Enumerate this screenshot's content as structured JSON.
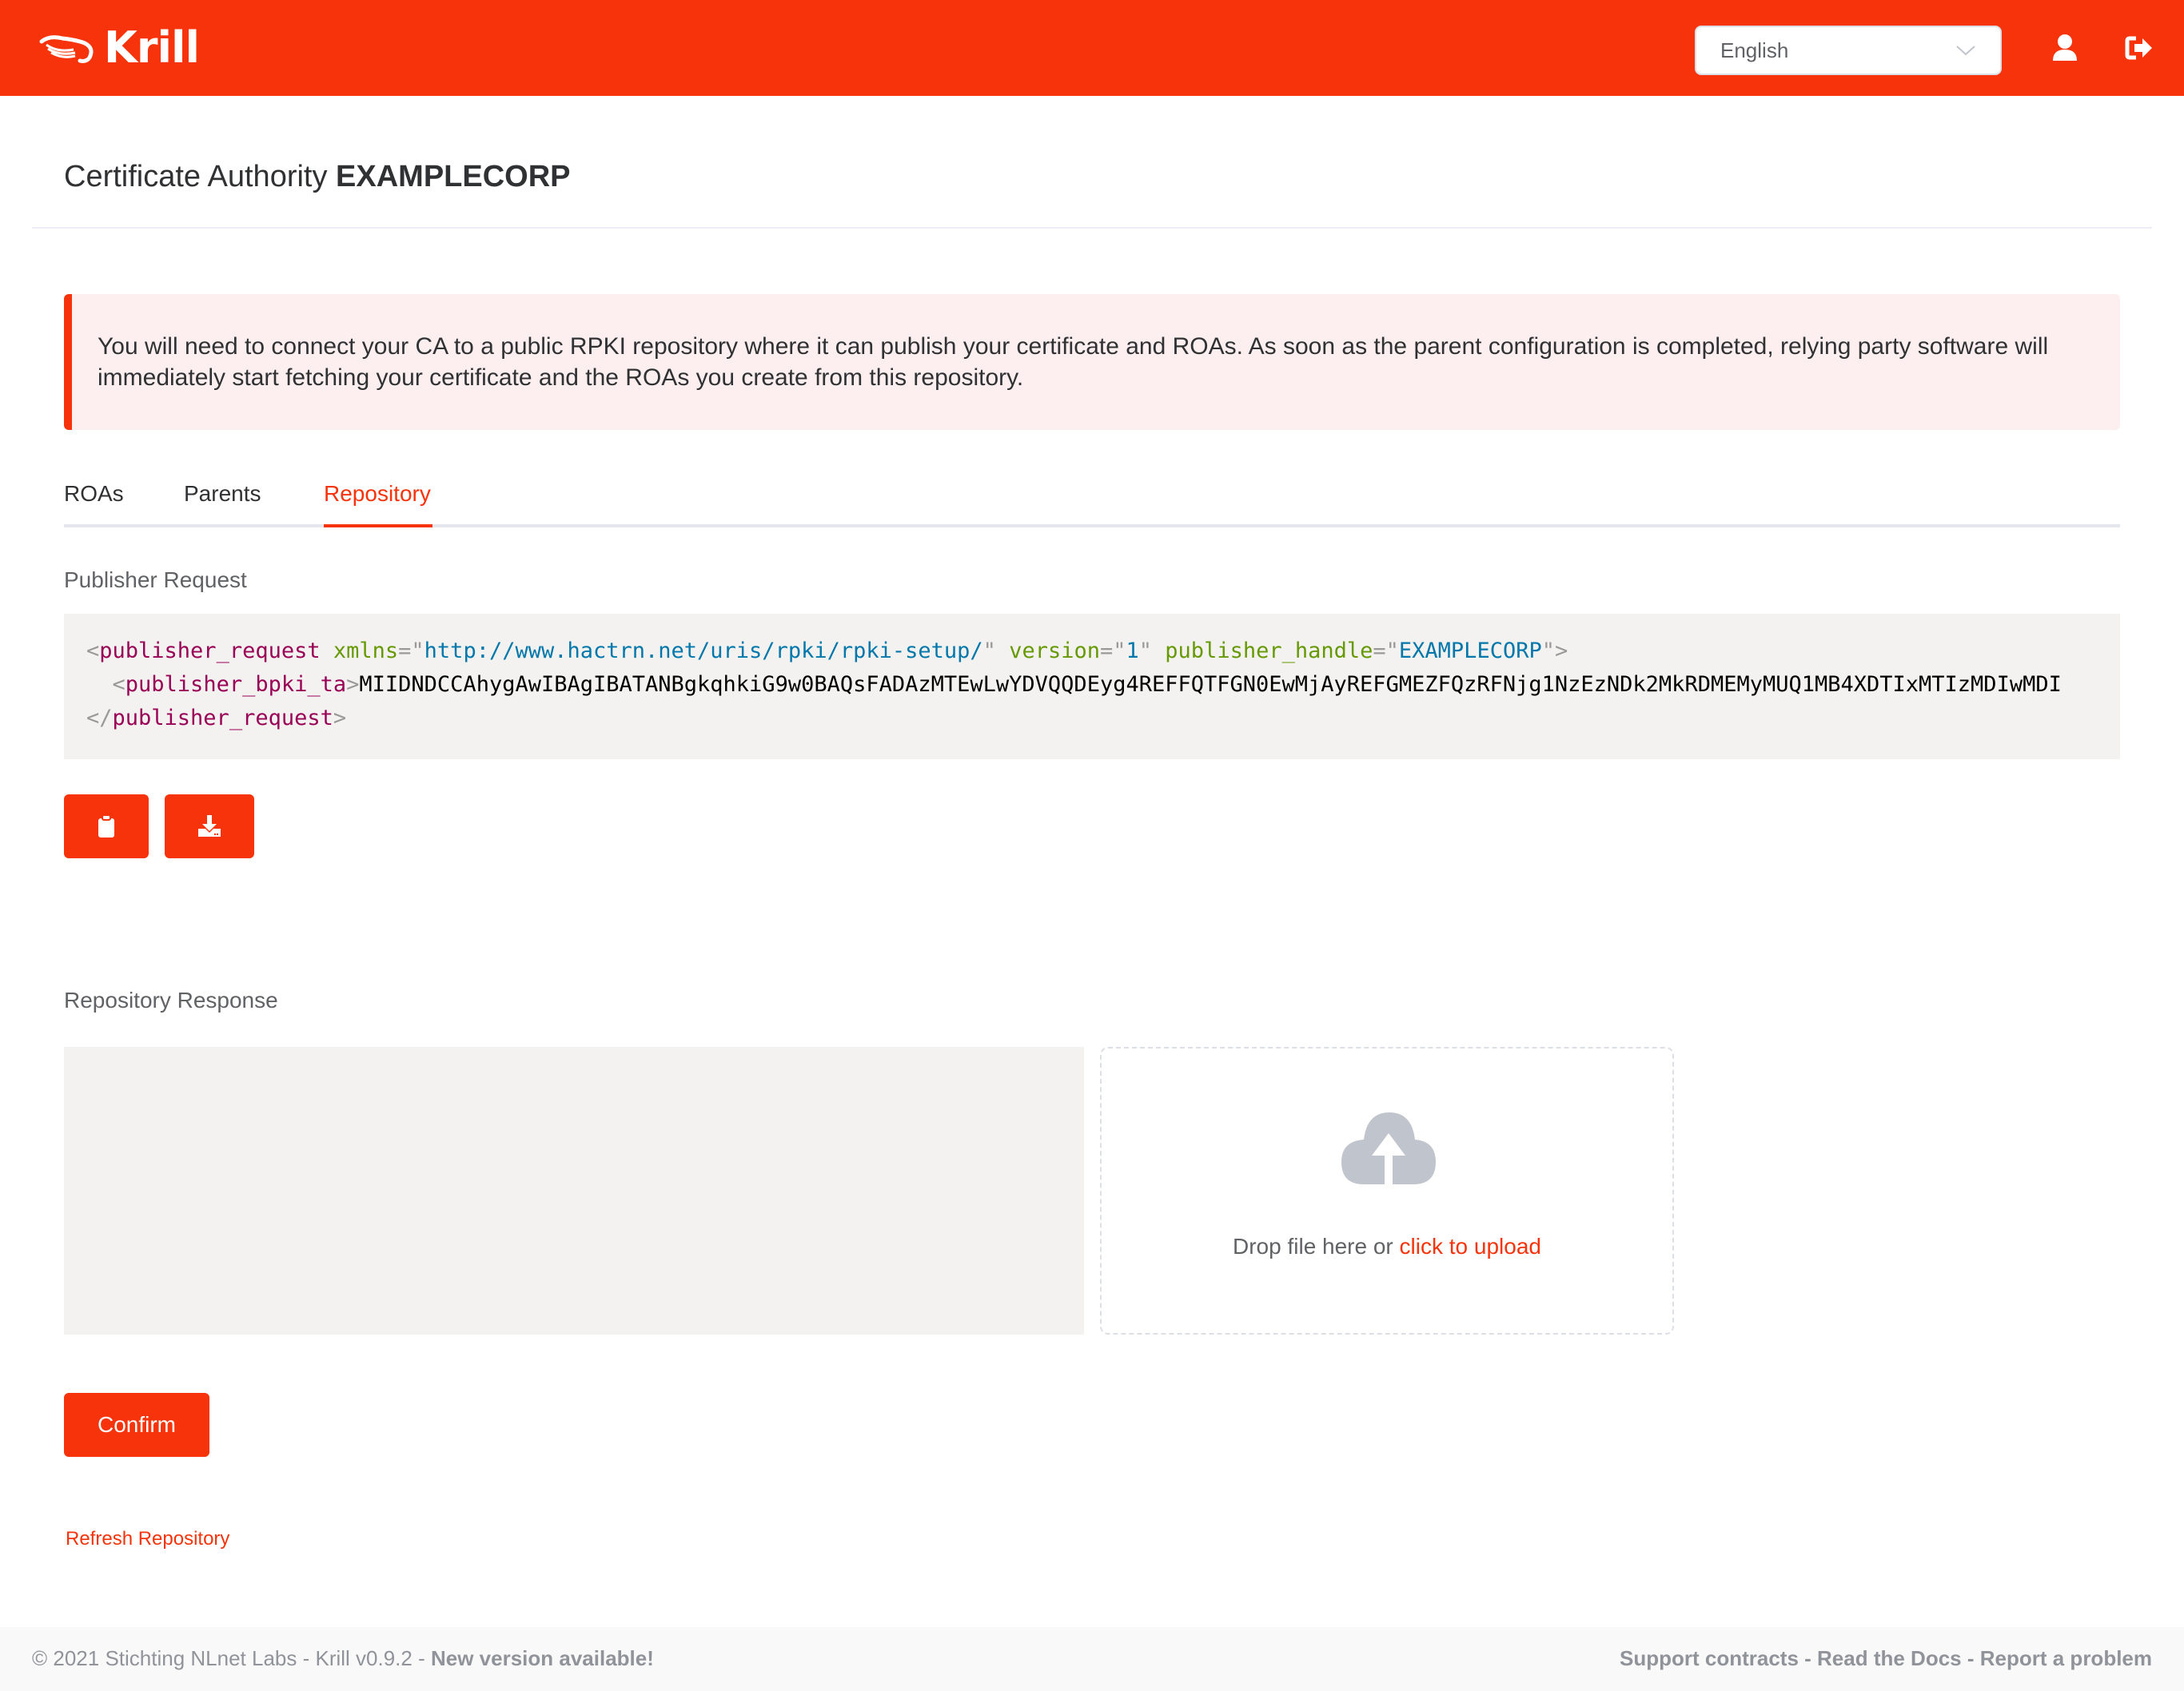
{
  "header": {
    "brand": "Krill",
    "language": {
      "selected": "English"
    },
    "icons": {
      "user": "user-icon",
      "logout": "sign-out-icon"
    }
  },
  "page": {
    "title_prefix": "Certificate Authority",
    "ca_name": "EXAMPLECORP"
  },
  "alert": {
    "message": "You will need to connect your CA to a public RPKI repository where it can publish your certificate and ROAs. As soon as the parent configuration is completed, relying party software will immediately start fetching your certificate and the ROAs you create from this repository."
  },
  "tabs": [
    {
      "label": "ROAs",
      "active": false
    },
    {
      "label": "Parents",
      "active": false
    },
    {
      "label": "Repository",
      "active": true
    }
  ],
  "publisher_request": {
    "label": "Publisher Request",
    "xml": {
      "root_tag": "publisher_request",
      "xmlns_attr": "xmlns",
      "xmlns_value": "http://www.hactrn.net/uris/rpki/rpki-setup/",
      "version_attr": "version",
      "version_value": "1",
      "handle_attr": "publisher_handle",
      "handle_value": "EXAMPLECORP",
      "child_tag": "publisher_bpki_ta",
      "child_value": "MIIDNDCCAhygAwIBAgIBATANBgkqhkiG9w0BAQsFADAzMTEwLwYDVQQDEyg4REFFQTFGN0EwMjAyREFGMEZFQzRFNjg1NzEzNDk2MkRDMEMyMUQ1MB4XDTIxMTIzMDIwMDI"
    },
    "copy_button_icon": "clipboard-icon",
    "download_button_icon": "download-icon"
  },
  "repository_response": {
    "label": "Repository Response",
    "textarea_value": "",
    "upload": {
      "icon": "cloud-upload-icon",
      "text": "Drop file here or",
      "link": "click to upload"
    }
  },
  "actions": {
    "confirm": "Confirm",
    "refresh": "Refresh Repository"
  },
  "footer": {
    "copyright": "© 2021 Stichting NLnet Labs - Krill v0.9.2 - ",
    "new_version": "New version available!",
    "links": [
      "Support contracts",
      "Read the Docs",
      "Report a problem"
    ],
    "separator": " - "
  },
  "colors": {
    "brand": "#f6330a",
    "alert_bg": "#fdeeef",
    "code_bg": "#f3f2f1",
    "footer_bg": "#f9f9f9"
  }
}
